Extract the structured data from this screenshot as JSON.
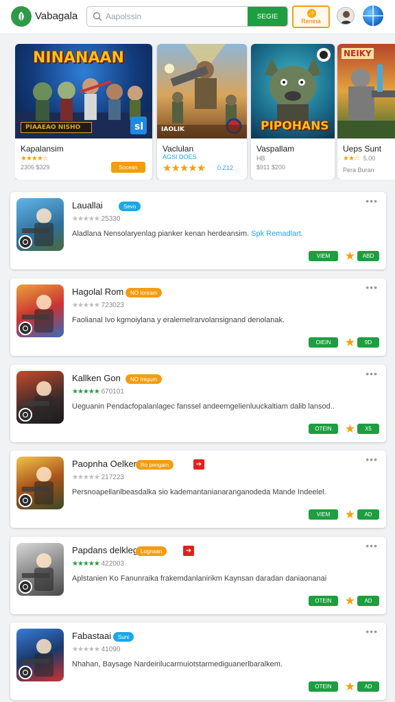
{
  "header": {
    "app_title": "Vabagala",
    "search_placeholder": "Aapolssin",
    "search_button": "SEGIE",
    "premium_label": "Renina",
    "premium_icon": "✨"
  },
  "featured": [
    {
      "banner": "NINANAAN",
      "sub_banner": "PIAAEAO NISHO",
      "title": "Kapalansim",
      "stars": "★★★★☆",
      "meta": "2306 $329",
      "button": "Socean"
    },
    {
      "banner": "IAOLIK",
      "title": "Vaclulan",
      "stars_label": "AGSI DOES",
      "stars": "★★★★★",
      "meta": "0.Z12"
    },
    {
      "banner": "PIPOHANS",
      "title": "Vaspallam",
      "sub": "HB",
      "meta": "$911 $200"
    },
    {
      "banner": "NEIKY",
      "title": "Ueps Sunt",
      "stars": "★★☆",
      "stars_value": "5.00",
      "meta": "Pera Buran"
    }
  ],
  "list": [
    {
      "title": "Lauallai",
      "badge": "Sevo",
      "badge_color": "blue",
      "flag": "",
      "stars": "★★★★★",
      "stars_green": false,
      "count": "25330",
      "desc": "Aladlana Nensolaryenlag pianker kenan herdeansim.",
      "link": "Spk Remadlart.",
      "install": "VIEM",
      "rating": "ABD"
    },
    {
      "title": "Hagolal Rom",
      "badge": "NO Ionram",
      "badge_color": "orange",
      "flag": "",
      "stars": "★★★★★",
      "stars_green": false,
      "count": "723023",
      "desc": "Faolianal Ivo kgmoiylana y eralemelrarvolansignand denolanak.",
      "link": "",
      "install": "OIEIN",
      "rating": "9D"
    },
    {
      "title": "Kallken Gon",
      "badge": "NO Iregum",
      "badge_color": "orange",
      "flag": "",
      "stars": "★★★★★",
      "stars_green": true,
      "count": "670101",
      "desc": "Ueguanin Pendacfopalanlagec fanssel andeemgelienluuckaltiam dalib lansod..",
      "link": "",
      "install": "OTEIN",
      "rating": "X5"
    },
    {
      "title": "Paopnha Oelken",
      "badge": "Ro pengam",
      "badge_color": "orange",
      "flag": "➔",
      "stars": "★★★★★",
      "stars_green": false,
      "count": "217223",
      "desc": "Persnoapellanlbeasdalka sio kademantanianaranganodeda Mande Indeelel.",
      "link": "",
      "install": "VIEM",
      "rating": "AD"
    },
    {
      "title": "Papdans delklege",
      "badge": "Lognaan",
      "badge_color": "orange",
      "flag": "➔",
      "stars": "★★★★★",
      "stars_green": true,
      "count": "422003",
      "desc": "Aplstanien Ko Fanunraika frakemdanlanirikm Kaynsan daradan daniaonanai",
      "link": "",
      "install": "OTEIN",
      "rating": "AD"
    },
    {
      "title": "Fabastaai",
      "badge": "Suni",
      "badge_color": "blue",
      "flag": "",
      "stars": "★★★★★",
      "stars_green": false,
      "count": "41090",
      "desc": "Nhahan, Baysage Nardeirilucarmuiotstarmediguanerlbaralkem.",
      "link": "",
      "install": "OTEIN",
      "rating": "AD"
    }
  ],
  "more_label": "•••"
}
